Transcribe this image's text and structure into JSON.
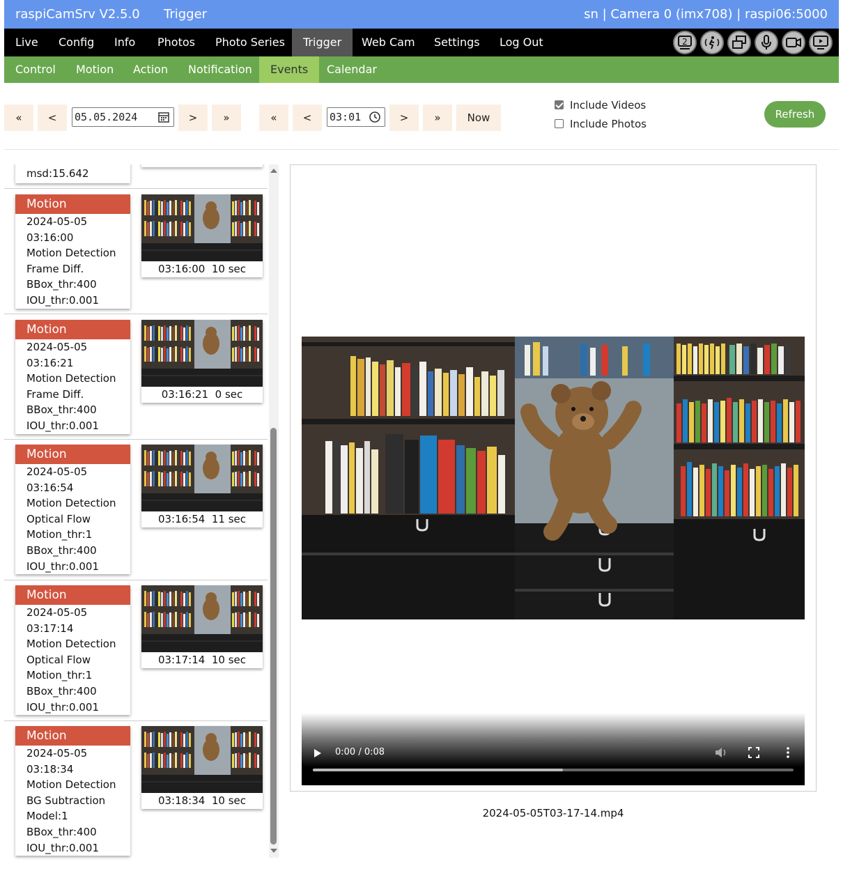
{
  "header": {
    "app_title": "raspiCamSrv V2.5.0",
    "page_title": "Trigger",
    "server_info": "sn | Camera 0 (imx708) | raspi06:5000"
  },
  "main_nav": {
    "items": [
      {
        "label": "Live"
      },
      {
        "label": "Config"
      },
      {
        "label": "Info"
      },
      {
        "label": "Photos"
      },
      {
        "label": "Photo Series"
      },
      {
        "label": "Trigger",
        "active": true
      },
      {
        "label": "Web Cam"
      },
      {
        "label": "Settings"
      },
      {
        "label": "Log Out"
      }
    ],
    "icons": [
      "camera-2-icon",
      "motion-trigger-icon",
      "multi-window-icon",
      "microphone-icon",
      "video-camera-icon",
      "screen-play-icon"
    ],
    "icon_badge": "2"
  },
  "sub_nav": {
    "items": [
      {
        "label": "Control"
      },
      {
        "label": "Motion"
      },
      {
        "label": "Action"
      },
      {
        "label": "Notification"
      },
      {
        "label": "Events",
        "active": true
      },
      {
        "label": "Calendar"
      }
    ]
  },
  "controls": {
    "date_first": "«",
    "date_prev": "<",
    "date_value": "05.05.2024",
    "date_next": ">",
    "date_last": "»",
    "time_first": "«",
    "time_prev": "<",
    "time_value": "03:01",
    "time_next": ">",
    "time_last": "»",
    "now_label": "Now",
    "include_videos": {
      "label": "Include Videos",
      "checked": true
    },
    "include_photos": {
      "label": "Include Photos",
      "checked": false
    },
    "refresh_label": "Refresh"
  },
  "partial_event": {
    "last_line": "msd:15.642"
  },
  "events": [
    {
      "type": "Motion",
      "date": "2024-05-05",
      "time": "03:16:00",
      "lines": [
        "Motion Detection",
        "Frame Diff.",
        "BBox_thr:400",
        "IOU_thr:0.001"
      ],
      "thumb_time": "03:16:00",
      "duration": "10 sec"
    },
    {
      "type": "Motion",
      "date": "2024-05-05",
      "time": "03:16:21",
      "lines": [
        "Motion Detection",
        "Frame Diff.",
        "BBox_thr:400",
        "IOU_thr:0.001"
      ],
      "thumb_time": "03:16:21",
      "duration": "0 sec"
    },
    {
      "type": "Motion",
      "date": "2024-05-05",
      "time": "03:16:54",
      "lines": [
        "Motion Detection",
        "Optical Flow",
        "Motion_thr:1",
        "BBox_thr:400",
        "IOU_thr:0.001"
      ],
      "thumb_time": "03:16:54",
      "duration": "11 sec"
    },
    {
      "type": "Motion",
      "date": "2024-05-05",
      "time": "03:17:14",
      "lines": [
        "Motion Detection",
        "Optical Flow",
        "Motion_thr:1",
        "BBox_thr:400",
        "IOU_thr:0.001"
      ],
      "thumb_time": "03:17:14",
      "duration": "10 sec"
    },
    {
      "type": "Motion",
      "date": "2024-05-05",
      "time": "03:18:34",
      "lines": [
        "Motion Detection",
        "BG Subtraction",
        "Model:1",
        "BBox_thr:400",
        "IOU_thr:0.001"
      ],
      "thumb_time": "03:18:34",
      "duration": "10 sec"
    }
  ],
  "video": {
    "time_display": "0:00 / 0:08",
    "buffered_fraction": 0.52,
    "filename": "2024-05-05T03-17-14.mp4"
  },
  "colors": {
    "title_bar": "#6495ed",
    "main_nav": "#000000",
    "sub_nav": "#6aa84f",
    "event_header": "#d2553f",
    "button_bg": "#fbefe3",
    "refresh": "#6aa84f"
  }
}
